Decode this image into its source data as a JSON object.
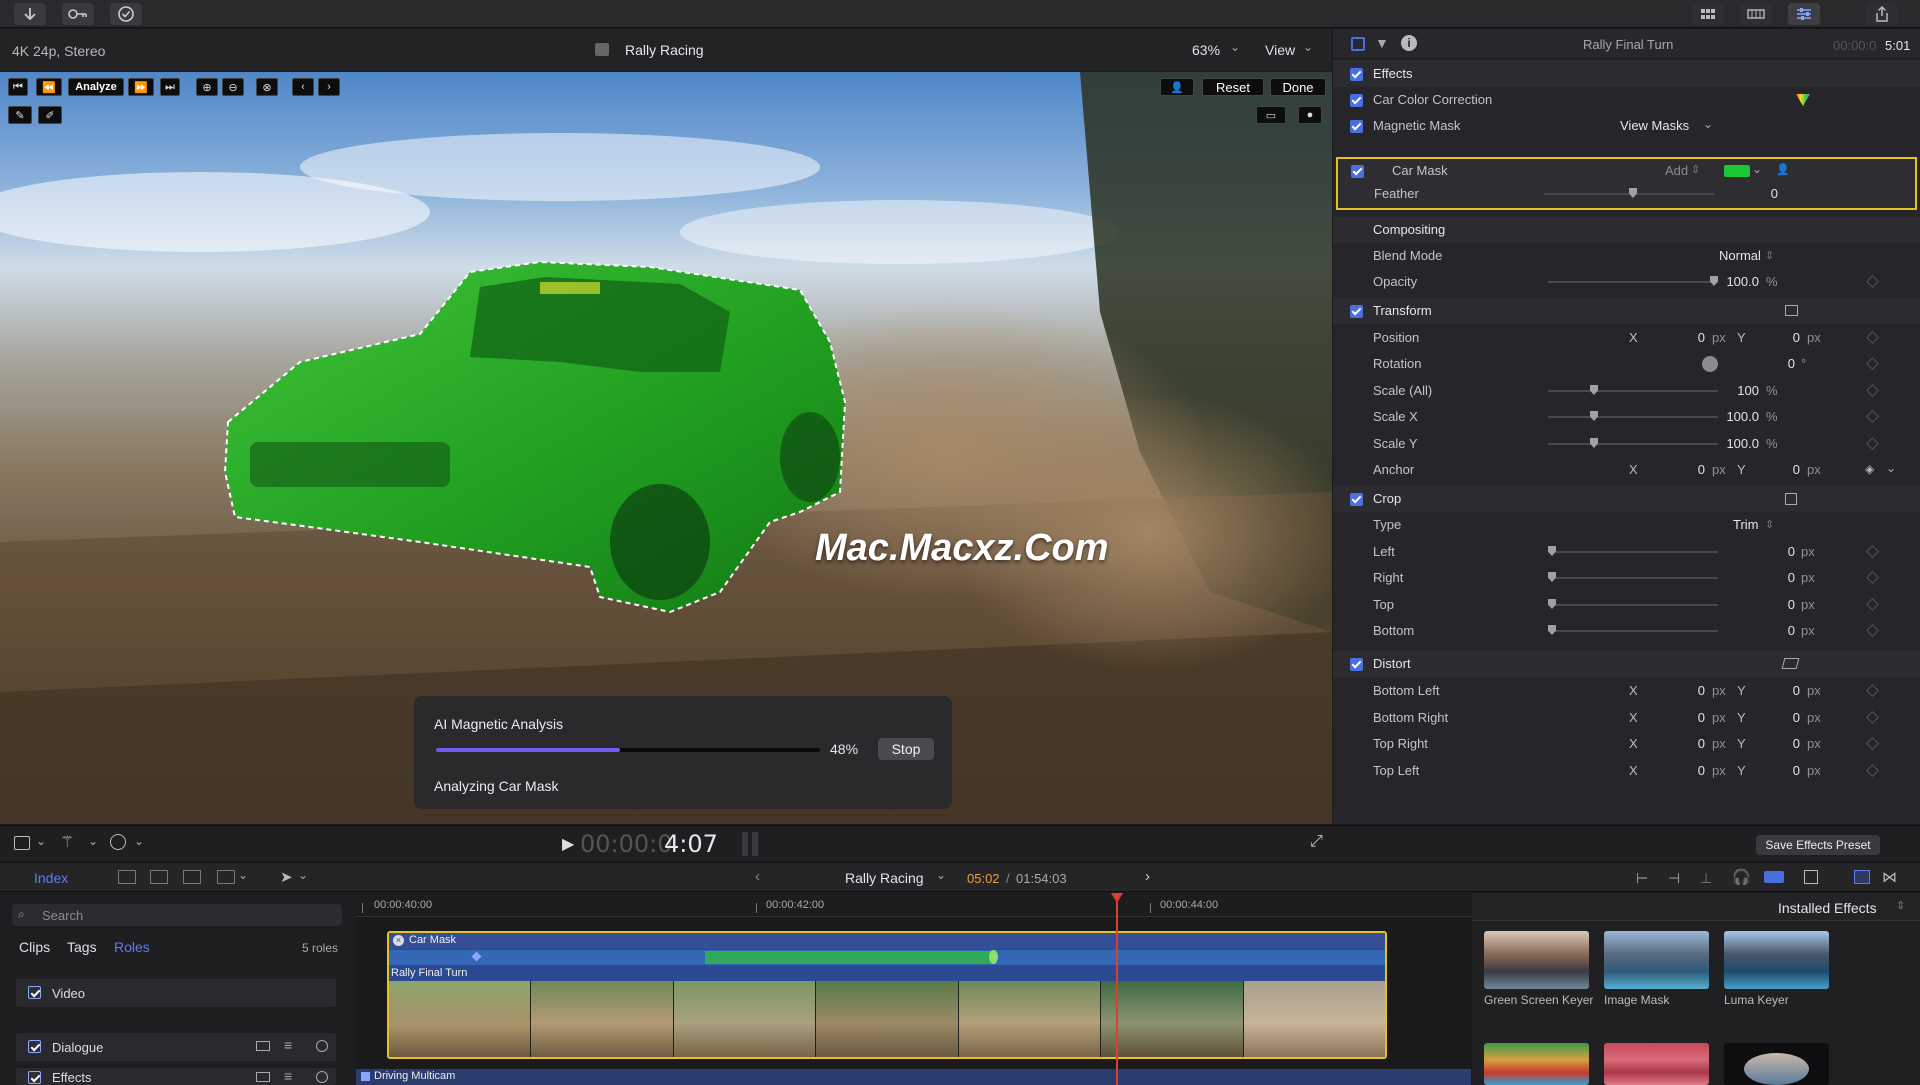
{
  "viewer": {
    "format": "4K 24p, Stereo",
    "project_title": "Rally Racing",
    "zoom": "63%",
    "view_menu": "View",
    "analyze_button": "Analyze",
    "reset_button": "Reset",
    "done_button": "Done",
    "watermark": "Mac.Macxz.Com",
    "analysis": {
      "title": "AI Magnetic Analysis",
      "percent_label": "48%",
      "progress": 0.48,
      "stop_button": "Stop",
      "status": "Analyzing Car Mask"
    },
    "timecode_dim": "00:00:0",
    "timecode_bright": "4:07"
  },
  "inspector": {
    "clip_name": "Rally Final Turn",
    "duration_dim": "00:00:0",
    "duration_bright": "5:01",
    "effects_label": "Effects",
    "car_color_correction": "Car Color Correction",
    "magnetic_mask": "Magnetic Mask",
    "view_masks": "View Masks",
    "car_mask": "Car Mask",
    "add_label": "Add",
    "mask_color": "#19c832",
    "feather_label": "Feather",
    "feather_value": "0",
    "compositing": "Compositing",
    "blend_mode_label": "Blend Mode",
    "blend_mode_value": "Normal",
    "opacity_label": "Opacity",
    "opacity_value": "100.0",
    "pct": "%",
    "transform": "Transform",
    "position_label": "Position",
    "x": "X",
    "y": "Y",
    "px": "px",
    "zero": "0",
    "rotation_label": "Rotation",
    "deg": "°",
    "scale_all_label": "Scale (All)",
    "scale_all_value": "100",
    "scale_x_label": "Scale X",
    "scale_x_value": "100.0",
    "scale_y_label": "Scale Y",
    "scale_y_value": "100.0",
    "anchor_label": "Anchor",
    "crop": "Crop",
    "type_label": "Type",
    "type_value": "Trim",
    "left_label": "Left",
    "right_label": "Right",
    "top_label": "Top",
    "bottom_label": "Bottom",
    "distort": "Distort",
    "bottom_left": "Bottom Left",
    "bottom_right": "Bottom Right",
    "top_right": "Top Right",
    "top_left": "Top Left",
    "save_preset": "Save Effects Preset"
  },
  "timeline": {
    "index_label": "Index",
    "project": "Rally Racing",
    "position": "05:02",
    "total": "01:54:03",
    "separator": "/",
    "ruler": [
      "00:00:40:00",
      "00:00:42:00",
      "00:00:44:00"
    ],
    "mask_clip": "Car Mask",
    "video_clip": "Rally Final Turn",
    "multicam_clip": "Driving Multicam"
  },
  "browser": {
    "search_placeholder": "Search",
    "tabs": [
      "Clips",
      "Tags",
      "Roles"
    ],
    "roles_count": "5 roles",
    "roles": [
      "Video",
      "Dialogue",
      "Effects"
    ]
  },
  "effects_browser": {
    "title": "Installed Effects",
    "items": [
      "Green Screen Keyer",
      "Image Mask",
      "Luma Keyer"
    ]
  },
  "colors": {
    "accent": "#4a6fe0",
    "selection": "#e6c21f",
    "mask_green": "#1f9c1f",
    "playhead": "#d9412e"
  }
}
